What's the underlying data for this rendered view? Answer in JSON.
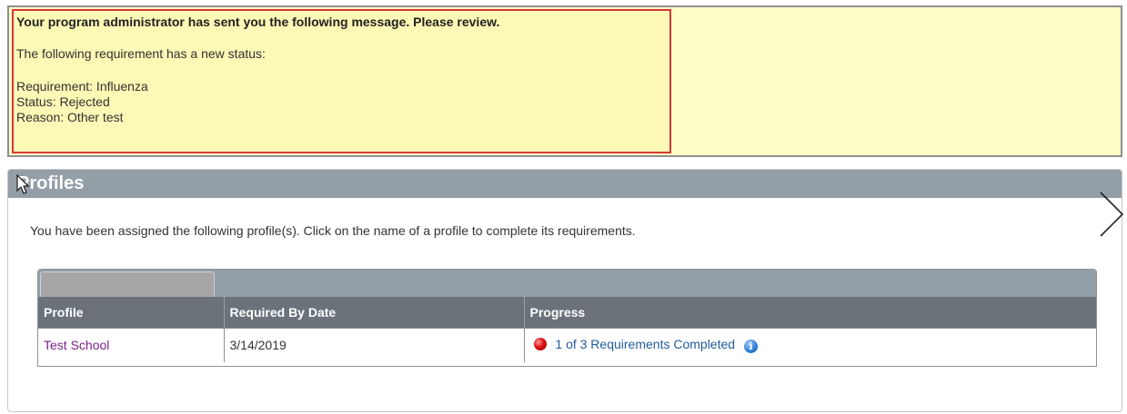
{
  "message": {
    "heading": "Your program administrator has sent you the following message. Please review.",
    "intro": "The following requirement has a new status:",
    "requirement": "Requirement: Influenza",
    "status": "Status: Rejected",
    "reason": "Reason: Other test"
  },
  "profiles": {
    "title": "Profiles",
    "intro": "You have been assigned the following profile(s). Click on the name of a profile to complete its requirements.",
    "columns": [
      "Profile",
      "Required By Date",
      "Progress"
    ],
    "rows": [
      {
        "profile": "Test School",
        "required_by": "3/14/2019",
        "progress": "1 of 3 Requirements Completed",
        "status_color": "#e01010"
      }
    ]
  },
  "icons": {
    "next": "chevron-right-icon",
    "info": "info-icon",
    "status": "red-status-dot-icon",
    "cursor": "mouse-pointer-icon"
  },
  "colors": {
    "banner_bg": "#fefdc6",
    "highlight_border": "#d8363a",
    "header_bg": "#939ea6",
    "table_header_bg": "#6b7279",
    "profile_link": "#7b1f8c",
    "progress_link": "#1f5b9a"
  }
}
